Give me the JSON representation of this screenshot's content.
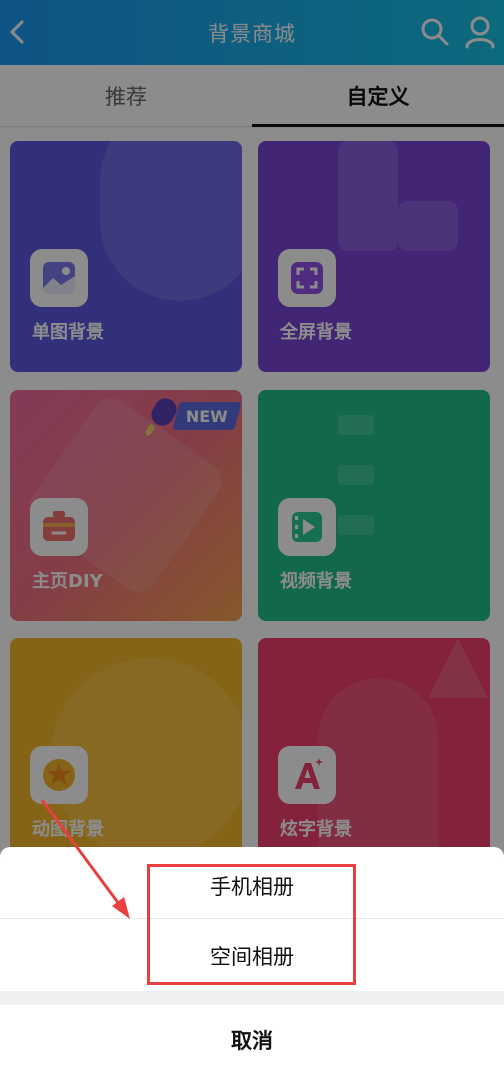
{
  "header": {
    "title": "背景商城"
  },
  "tabs": [
    {
      "label": "推荐",
      "active": false
    },
    {
      "label": "自定义",
      "active": true
    }
  ],
  "cards": [
    {
      "label": "单图背景",
      "color": "#5b58e0"
    },
    {
      "label": "全屏背景",
      "color": "#7a44d8"
    },
    {
      "label": "主页DIY",
      "color": "#f06aa0",
      "badge": "NEW"
    },
    {
      "label": "视频背景",
      "color": "#1fbe8c"
    },
    {
      "label": "动图背景",
      "color": "#f5b72a"
    },
    {
      "label": "炫字背景",
      "color": "#ee3f6a"
    }
  ],
  "sheet": {
    "options": [
      "手机相册",
      "空间相册"
    ],
    "cancel": "取消"
  },
  "colors": {
    "accent": "#1aa6ee",
    "highlight": "#e84040"
  }
}
